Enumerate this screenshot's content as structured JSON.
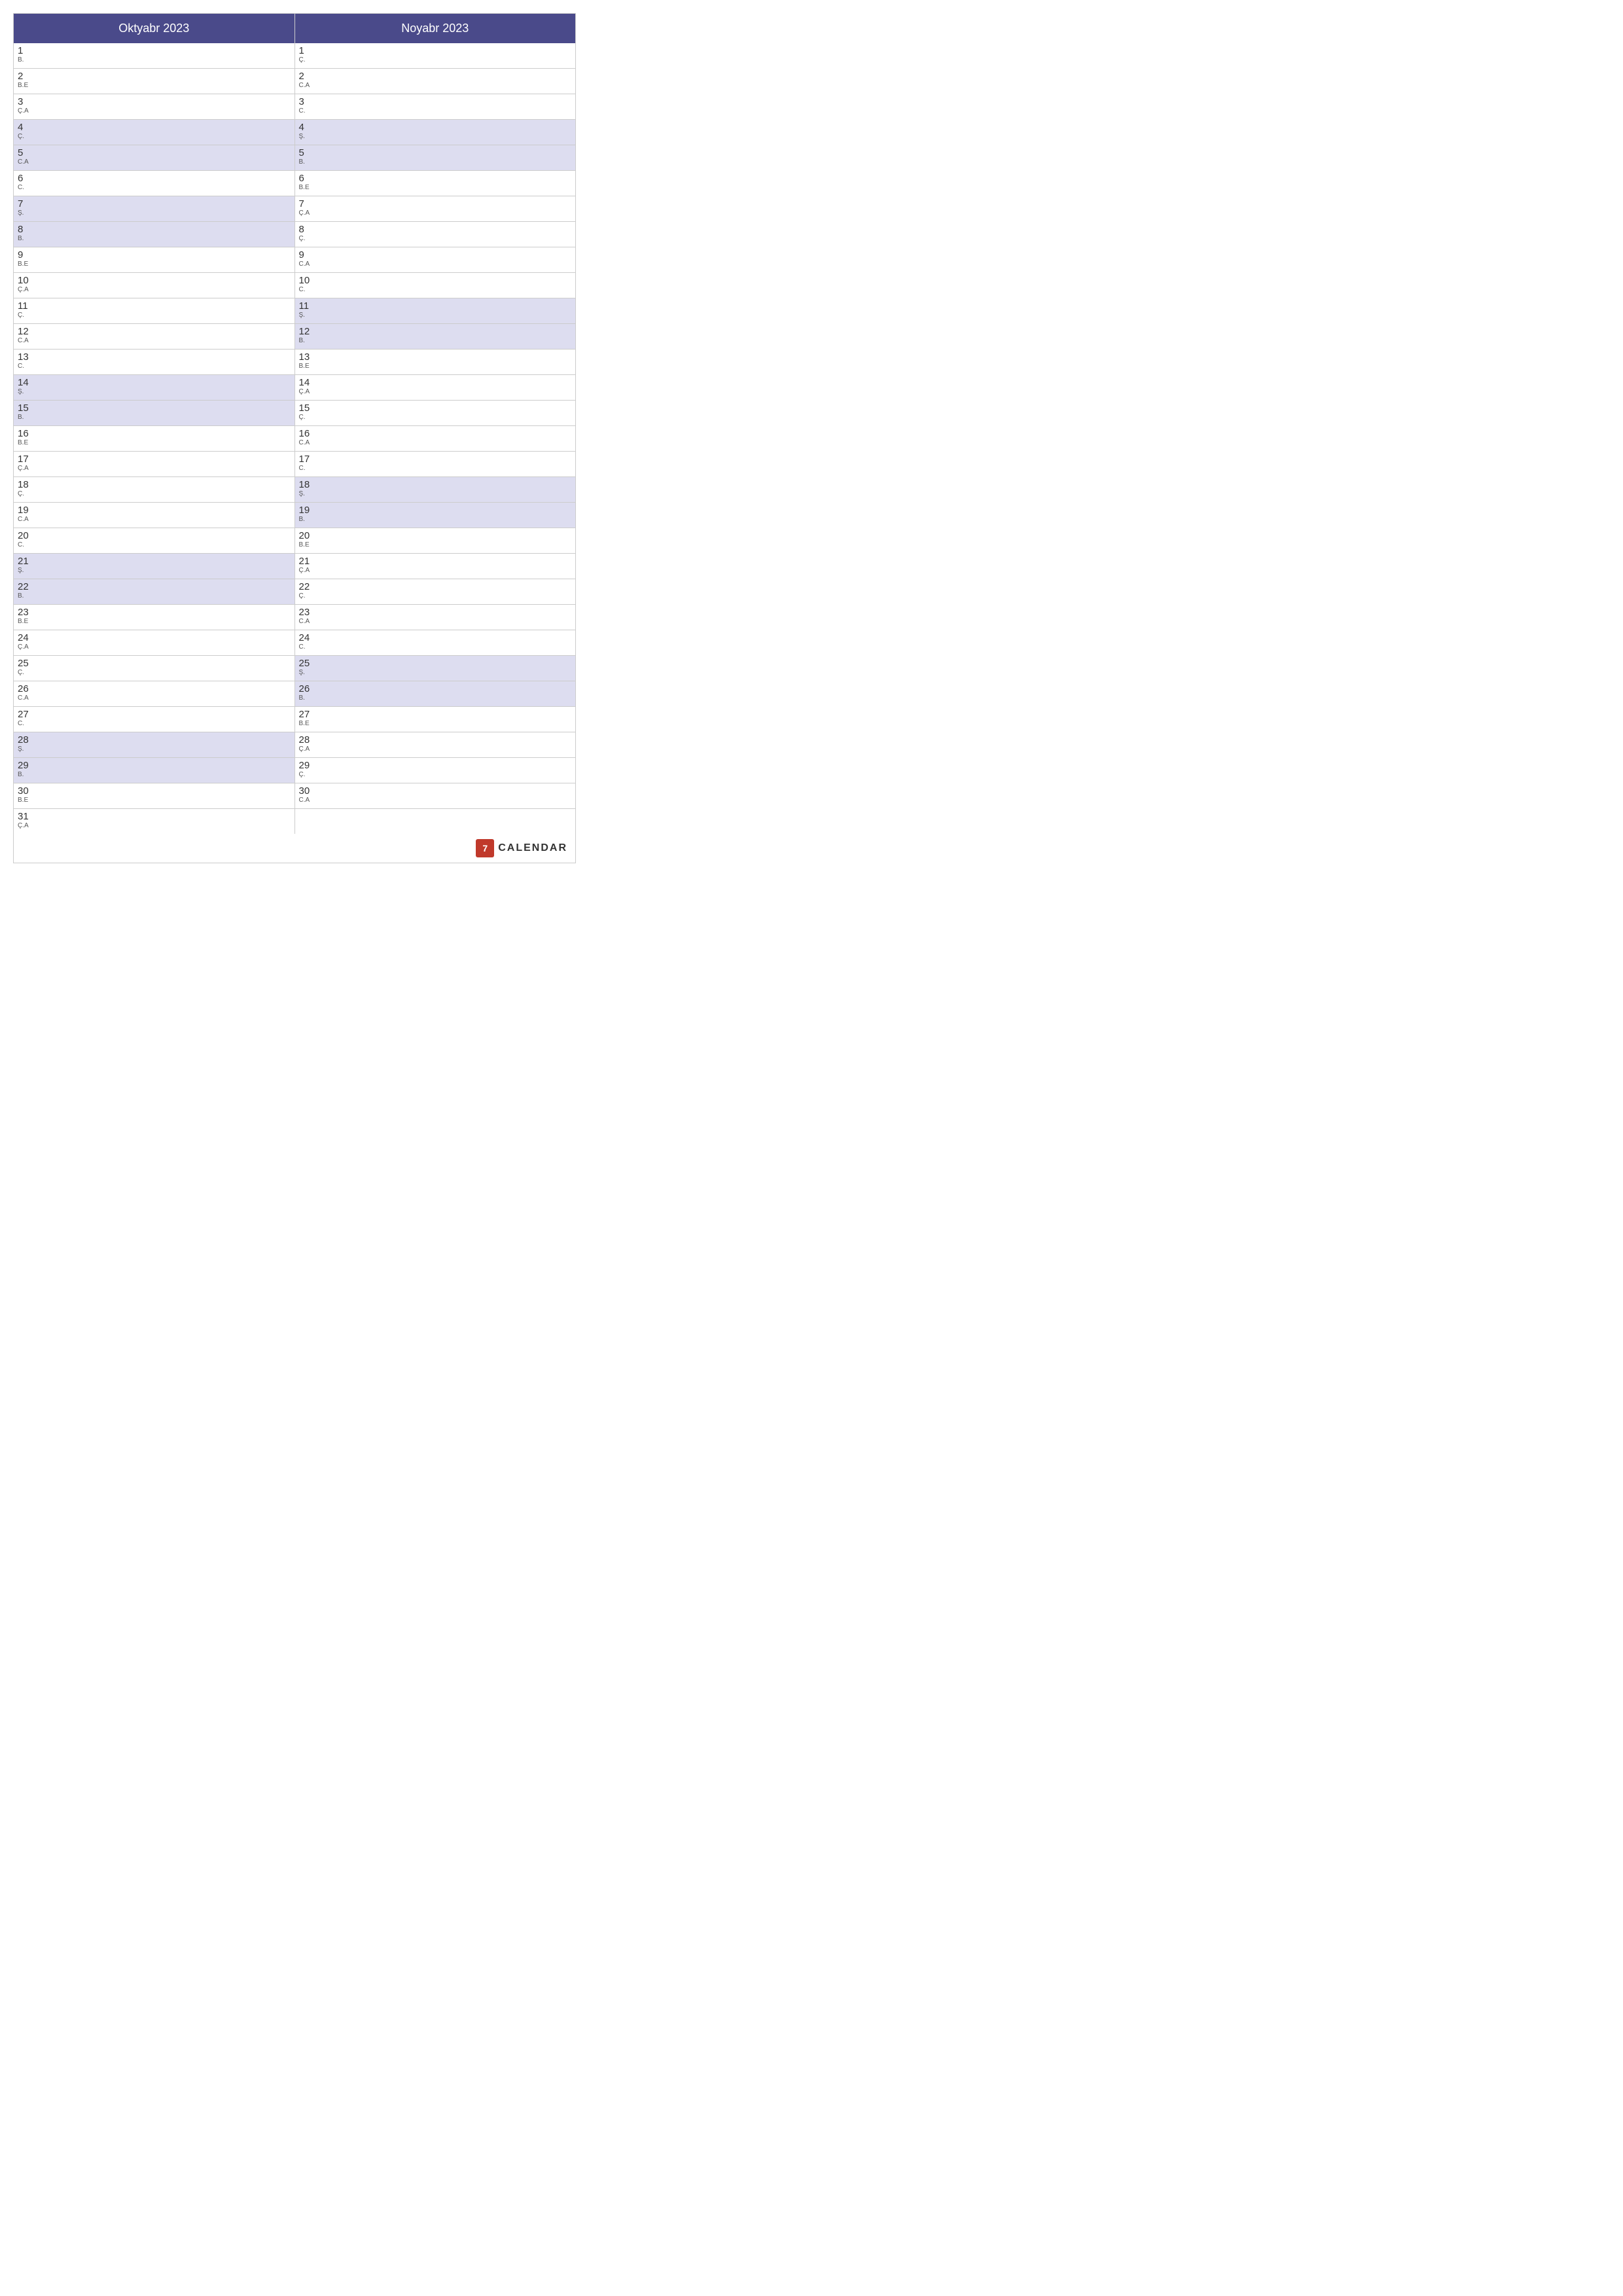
{
  "months": [
    {
      "name": "Oktyabr 2023",
      "days": [
        {
          "num": "1",
          "dayName": "B.",
          "weekend": false
        },
        {
          "num": "2",
          "dayName": "B.E",
          "weekend": false
        },
        {
          "num": "3",
          "dayName": "Ç.A",
          "weekend": false
        },
        {
          "num": "4",
          "dayName": "Ç.",
          "weekend": true
        },
        {
          "num": "5",
          "dayName": "C.A",
          "weekend": true
        },
        {
          "num": "6",
          "dayName": "C.",
          "weekend": false
        },
        {
          "num": "7",
          "dayName": "Ş.",
          "weekend": true
        },
        {
          "num": "8",
          "dayName": "B.",
          "weekend": true
        },
        {
          "num": "9",
          "dayName": "B.E",
          "weekend": false
        },
        {
          "num": "10",
          "dayName": "Ç.A",
          "weekend": false
        },
        {
          "num": "11",
          "dayName": "Ç.",
          "weekend": false
        },
        {
          "num": "12",
          "dayName": "C.A",
          "weekend": false
        },
        {
          "num": "13",
          "dayName": "C.",
          "weekend": false
        },
        {
          "num": "14",
          "dayName": "Ş.",
          "weekend": true
        },
        {
          "num": "15",
          "dayName": "B.",
          "weekend": true
        },
        {
          "num": "16",
          "dayName": "B.E",
          "weekend": false
        },
        {
          "num": "17",
          "dayName": "Ç.A",
          "weekend": false
        },
        {
          "num": "18",
          "dayName": "Ç.",
          "weekend": false
        },
        {
          "num": "19",
          "dayName": "C.A",
          "weekend": false
        },
        {
          "num": "20",
          "dayName": "C.",
          "weekend": false
        },
        {
          "num": "21",
          "dayName": "Ş.",
          "weekend": true
        },
        {
          "num": "22",
          "dayName": "B.",
          "weekend": true
        },
        {
          "num": "23",
          "dayName": "B.E",
          "weekend": false
        },
        {
          "num": "24",
          "dayName": "Ç.A",
          "weekend": false
        },
        {
          "num": "25",
          "dayName": "Ç.",
          "weekend": false
        },
        {
          "num": "26",
          "dayName": "C.A",
          "weekend": false
        },
        {
          "num": "27",
          "dayName": "C.",
          "weekend": false
        },
        {
          "num": "28",
          "dayName": "Ş.",
          "weekend": true
        },
        {
          "num": "29",
          "dayName": "B.",
          "weekend": true
        },
        {
          "num": "30",
          "dayName": "B.E",
          "weekend": false
        },
        {
          "num": "31",
          "dayName": "Ç.A",
          "weekend": false
        }
      ]
    },
    {
      "name": "Noyabr 2023",
      "days": [
        {
          "num": "1",
          "dayName": "Ç.",
          "weekend": false
        },
        {
          "num": "2",
          "dayName": "C.A",
          "weekend": false
        },
        {
          "num": "3",
          "dayName": "C.",
          "weekend": false
        },
        {
          "num": "4",
          "dayName": "Ş.",
          "weekend": true
        },
        {
          "num": "5",
          "dayName": "B.",
          "weekend": true
        },
        {
          "num": "6",
          "dayName": "B.E",
          "weekend": false
        },
        {
          "num": "7",
          "dayName": "Ç.A",
          "weekend": false
        },
        {
          "num": "8",
          "dayName": "Ç.",
          "weekend": false
        },
        {
          "num": "9",
          "dayName": "C.A",
          "weekend": false
        },
        {
          "num": "10",
          "dayName": "C.",
          "weekend": false
        },
        {
          "num": "11",
          "dayName": "Ş.",
          "weekend": true
        },
        {
          "num": "12",
          "dayName": "B.",
          "weekend": true
        },
        {
          "num": "13",
          "dayName": "B.E",
          "weekend": false
        },
        {
          "num": "14",
          "dayName": "Ç.A",
          "weekend": false
        },
        {
          "num": "15",
          "dayName": "Ç.",
          "weekend": false
        },
        {
          "num": "16",
          "dayName": "C.A",
          "weekend": false
        },
        {
          "num": "17",
          "dayName": "C.",
          "weekend": false
        },
        {
          "num": "18",
          "dayName": "Ş.",
          "weekend": true
        },
        {
          "num": "19",
          "dayName": "B.",
          "weekend": true
        },
        {
          "num": "20",
          "dayName": "B.E",
          "weekend": false
        },
        {
          "num": "21",
          "dayName": "Ç.A",
          "weekend": false
        },
        {
          "num": "22",
          "dayName": "Ç.",
          "weekend": false
        },
        {
          "num": "23",
          "dayName": "C.A",
          "weekend": false
        },
        {
          "num": "24",
          "dayName": "C.",
          "weekend": false
        },
        {
          "num": "25",
          "dayName": "Ş.",
          "weekend": true
        },
        {
          "num": "26",
          "dayName": "B.",
          "weekend": true
        },
        {
          "num": "27",
          "dayName": "B.E",
          "weekend": false
        },
        {
          "num": "28",
          "dayName": "Ç.A",
          "weekend": false
        },
        {
          "num": "29",
          "dayName": "Ç.",
          "weekend": false
        },
        {
          "num": "30",
          "dayName": "C.A",
          "weekend": false
        }
      ]
    }
  ],
  "footer": {
    "logo_text": "CALENDAR",
    "logo_icon": "7"
  }
}
